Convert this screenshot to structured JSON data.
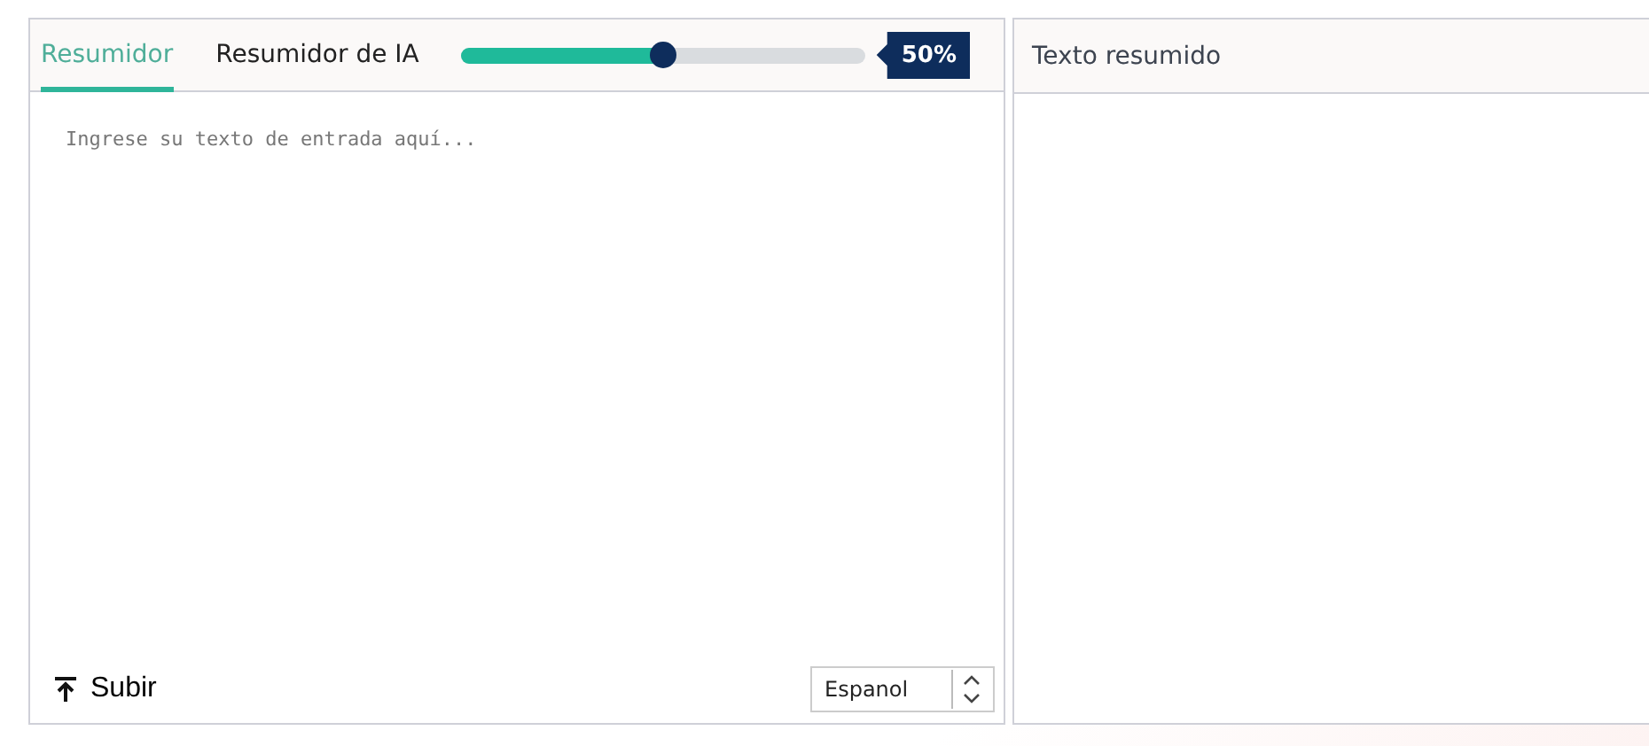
{
  "tabs": [
    {
      "label": "Resumidor",
      "selected": true
    },
    {
      "label": "Resumidor de IA",
      "selected": false
    }
  ],
  "length_slider": {
    "level": 0.5,
    "reading": "50%"
  },
  "input": {
    "placeholder": "Ingrese su texto de entrada aquí..."
  },
  "upload_button": {
    "label": "Subir"
  },
  "language_select": {
    "value": "Espanol"
  },
  "output": {
    "title": "Texto resumido"
  }
}
